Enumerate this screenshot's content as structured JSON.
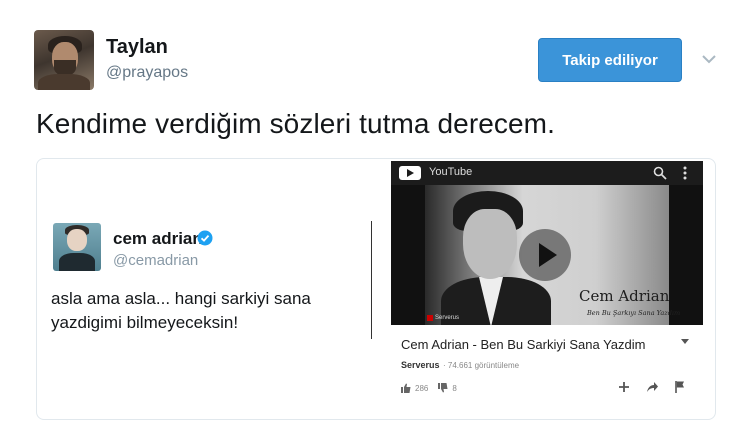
{
  "author": {
    "name": "Taylan",
    "handle": "@prayapos",
    "follow_label": "Takip ediliyor"
  },
  "tweet": {
    "text": "Kendime verdiğim sözleri tutma derecem."
  },
  "quoted_tweet": {
    "name": "cem adrian",
    "handle": "@cemadrian",
    "text": "asla ama asla... hangi sarkiyi sana yazdigimi bilmeyeceksin!"
  },
  "youtube": {
    "app_title": "YouTube",
    "overlay_name": "Cem Adrian",
    "overlay_song": "Ben Bu Şarkıyı Sana Yazdım",
    "overlay_channel": "Serverus",
    "video_title": "Cem Adrian - Ben Bu Sarkiyi Sana Yazdim",
    "channel": "Serverus",
    "views": "· 74.661 görüntüleme",
    "likes": "286",
    "dislikes": "8"
  },
  "colors": {
    "follow_button": "#3b94d9",
    "handle_gray": "#657786",
    "verified_blue": "#1da1f2"
  }
}
